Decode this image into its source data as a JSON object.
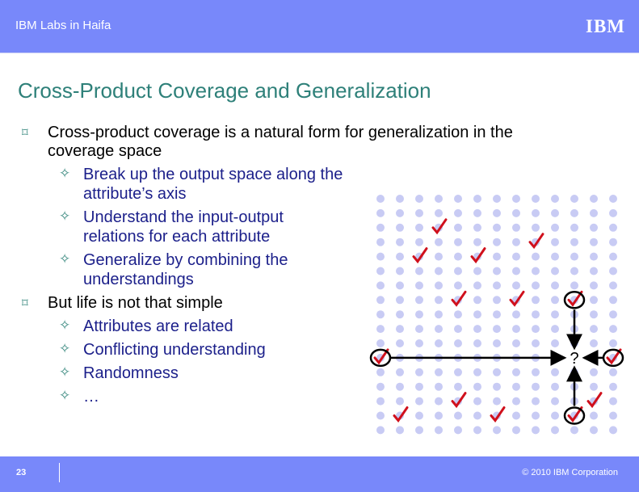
{
  "header": {
    "title": "IBM Labs in Haifa",
    "logo": "IBM"
  },
  "slide_title": "Cross-Product Coverage and Generalization",
  "bullets": [
    {
      "level": 1,
      "lines": [
        "Cross-product coverage is a natural form for generalization in the",
        "coverage space"
      ]
    },
    {
      "level": 2,
      "lines": [
        "Break up the output space along the",
        "attribute’s axis"
      ]
    },
    {
      "level": 2,
      "lines": [
        "Understand the input-output",
        "relations for each attribute"
      ]
    },
    {
      "level": 2,
      "lines": [
        "Generalize by combining the",
        "understandings"
      ]
    },
    {
      "level": 1,
      "lines": [
        "But life is not that simple"
      ]
    },
    {
      "level": 2,
      "lines": [
        "Attributes are related"
      ]
    },
    {
      "level": 2,
      "lines": [
        "Conflicting understanding"
      ]
    },
    {
      "level": 2,
      "lines": [
        "Randomness"
      ]
    },
    {
      "level": 2,
      "lines": [
        "…"
      ]
    }
  ],
  "figure": {
    "columns": 13,
    "rows": 17,
    "dot_color": "#C8CBF4",
    "check_color": "#D0101C",
    "checks": [
      [
        3,
        2
      ],
      [
        8,
        3
      ],
      [
        2,
        4
      ],
      [
        5,
        4
      ],
      [
        4,
        7
      ],
      [
        7,
        7
      ],
      [
        10,
        7
      ],
      [
        0,
        11
      ],
      [
        12,
        11
      ],
      [
        4,
        14
      ],
      [
        11,
        14
      ],
      [
        1,
        15
      ],
      [
        6,
        15
      ],
      [
        10,
        15
      ]
    ],
    "circled": [
      [
        10,
        7
      ],
      [
        0,
        11
      ],
      [
        12,
        11
      ],
      [
        10,
        15
      ]
    ],
    "unknown": {
      "col": 10,
      "row": 11,
      "label": "?"
    },
    "arrows_from": [
      [
        0,
        11
      ],
      [
        10,
        7
      ],
      [
        12,
        11
      ],
      [
        10,
        15
      ]
    ]
  },
  "footer": {
    "page": "23",
    "copyright": "© 2010 IBM Corporation"
  }
}
